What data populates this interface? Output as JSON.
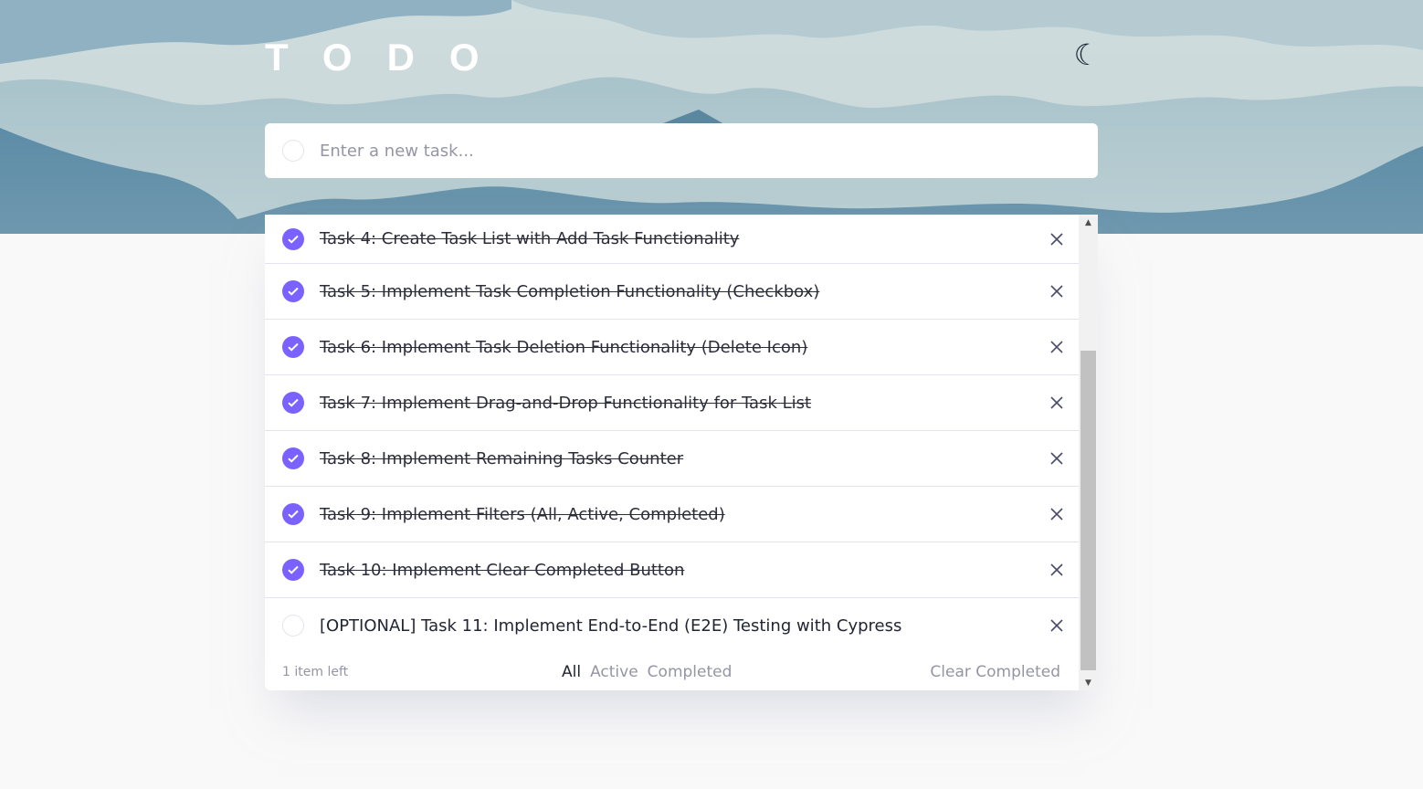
{
  "app": {
    "title": "TODO",
    "theme_toggle_icon": "☾"
  },
  "new_task": {
    "placeholder": "Enter a new task..."
  },
  "colors": {
    "accent_check": "#7b61ff",
    "text_dark": "#222533",
    "muted": "#9495a5",
    "divider": "#e3e4f1"
  },
  "tasks": [
    {
      "text": "Task 4: Create Task List with Add Task Functionality",
      "completed": true
    },
    {
      "text": "Task 5: Implement Task Completion Functionality (Checkbox)",
      "completed": true
    },
    {
      "text": "Task 6: Implement Task Deletion Functionality (Delete Icon)",
      "completed": true
    },
    {
      "text": "Task 7: Implement Drag-and-Drop Functionality for Task List",
      "completed": true
    },
    {
      "text": "Task 8: Implement Remaining Tasks Counter",
      "completed": true
    },
    {
      "text": "Task 9: Implement Filters (All, Active, Completed)",
      "completed": true
    },
    {
      "text": "Task 10: Implement Clear Completed Button",
      "completed": true
    },
    {
      "text": "[OPTIONAL] Task 11: Implement End-to-End (E2E) Testing with Cypress",
      "completed": false
    }
  ],
  "footer": {
    "items_left": "1 item left",
    "filters": [
      {
        "label": "All",
        "active": true
      },
      {
        "label": "Active",
        "active": false
      },
      {
        "label": "Completed",
        "active": false
      }
    ],
    "clear_label": "Clear Completed"
  }
}
